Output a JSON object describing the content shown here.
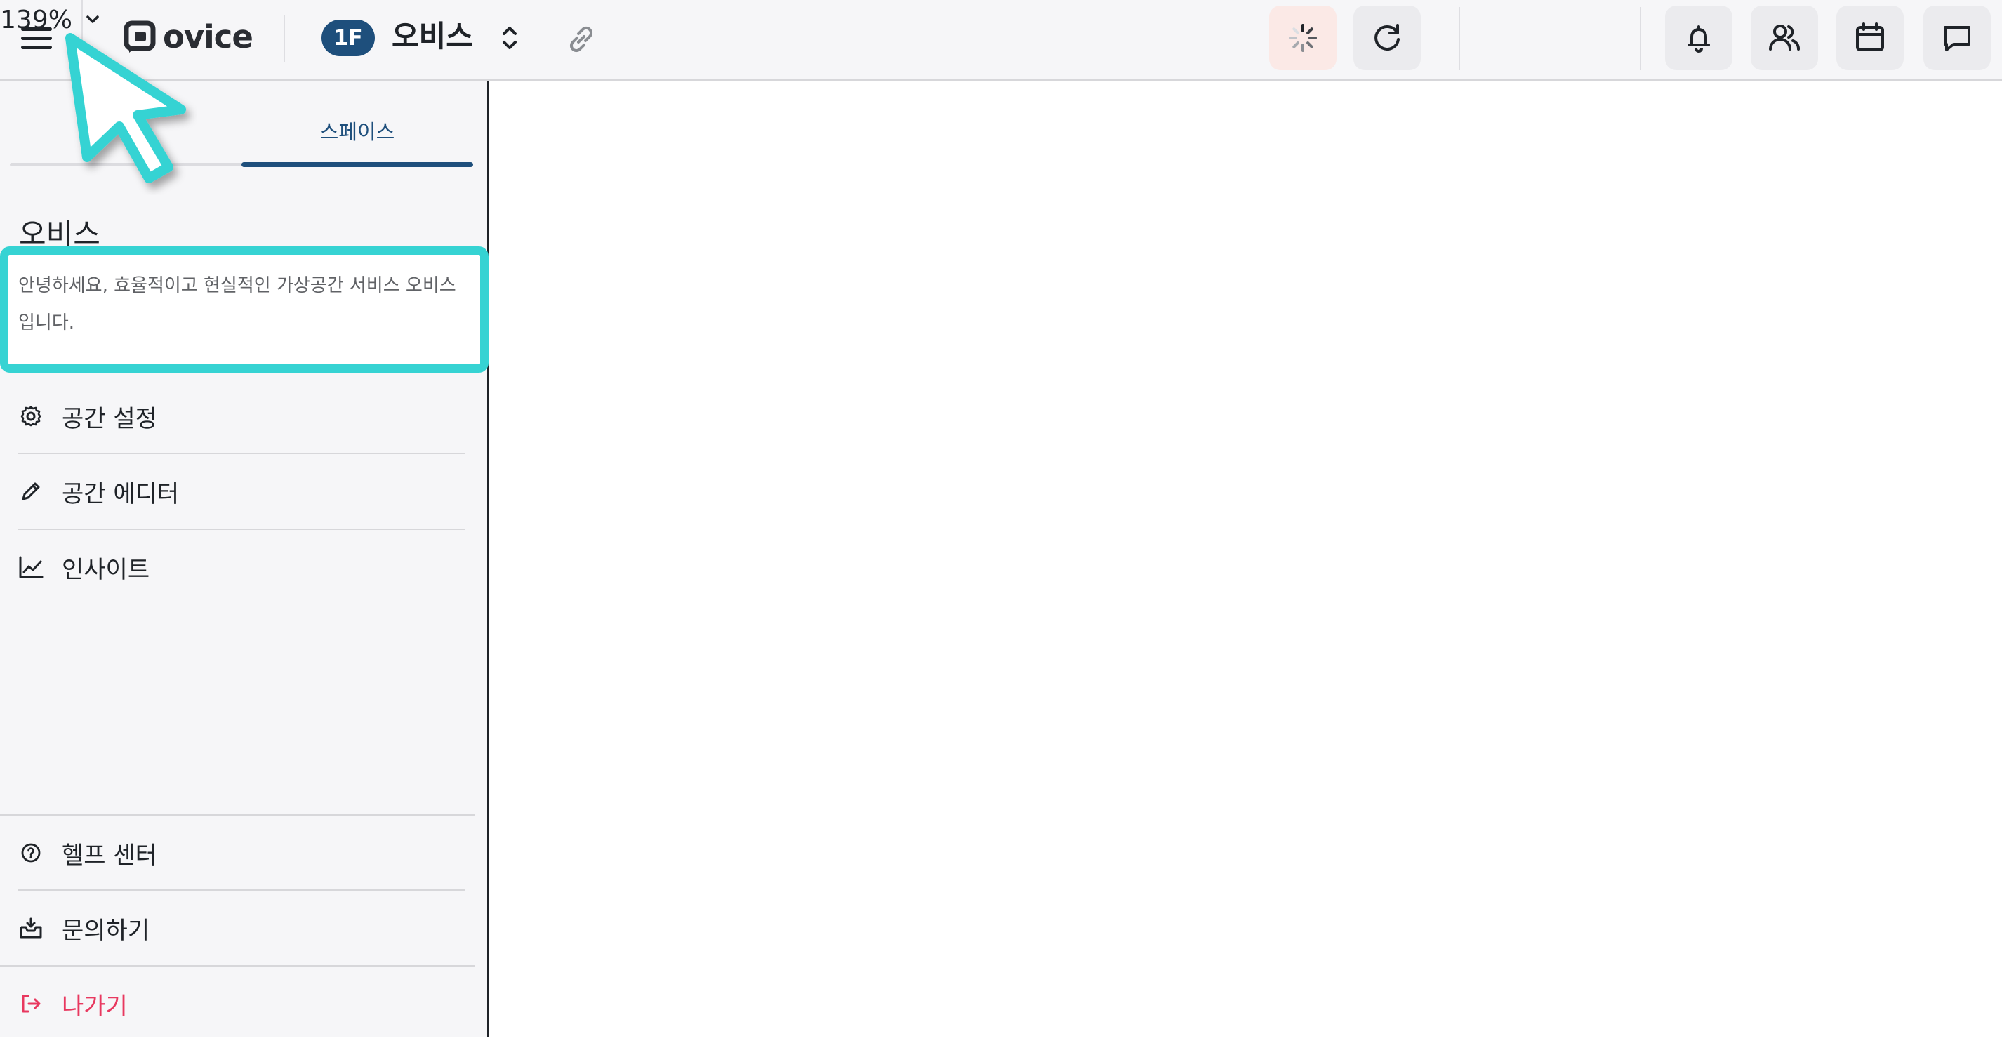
{
  "header": {
    "logo_text": "ovice",
    "floor_badge": "1F",
    "space_name": "오비스",
    "zoom_label": "139%",
    "icons": [
      "menu-icon",
      "ovice-logo-icon",
      "updown-chevron-icon",
      "link-icon",
      "loading-spinner-icon",
      "refresh-icon",
      "chevron-down-icon",
      "bell-icon",
      "users-icon",
      "calendar-icon",
      "chat-icon"
    ]
  },
  "sidebar": {
    "tab_label": "스페이스",
    "space_title": "오비스",
    "description": "안녕하세요, 효율적이고 현실적인 가상공간 서비스 오비스입니다.",
    "menu": [
      {
        "label": "공간 설정",
        "icon": "gear-icon"
      },
      {
        "label": "공간 에디터",
        "icon": "pencil-icon"
      },
      {
        "label": "인사이트",
        "icon": "chart-line-icon"
      }
    ],
    "footer": [
      {
        "label": "헬프 센터",
        "icon": "help-circle-icon"
      },
      {
        "label": "문의하기",
        "icon": "inbox-icon"
      },
      {
        "label": "나가기",
        "icon": "logout-icon"
      }
    ]
  },
  "colors": {
    "accent": "#1e4f7c",
    "highlight": "#36d3d3",
    "danger": "#e8385f",
    "spinner_bg": "#fbe9e6"
  }
}
